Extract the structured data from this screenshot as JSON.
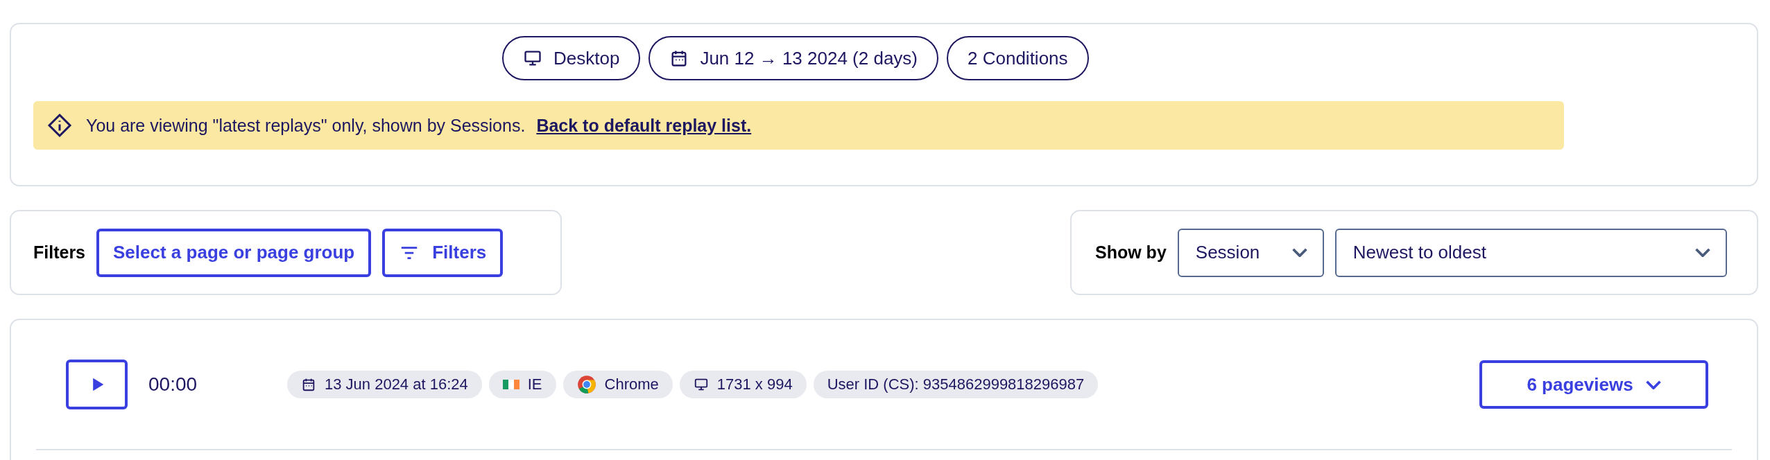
{
  "summary_pills": [
    {
      "kind": "device",
      "label": "Desktop"
    },
    {
      "kind": "date",
      "label": "Jun 12 → 13 2024 (2 days)"
    },
    {
      "kind": "plain",
      "label": "2 Conditions"
    }
  ],
  "notice": {
    "text": "You are viewing \"latest replays\" only, shown by Sessions.",
    "link": "Back to default replay list."
  },
  "filters": {
    "label": "Filters",
    "page_select": "Select a page or page group",
    "filters_button": "Filters"
  },
  "show_by": {
    "label": "Show by",
    "grouping": "Session",
    "sort": "Newest to oldest"
  },
  "sessions": [
    {
      "duration": "00:00",
      "pageviews": "6 pageviews",
      "chips": [
        {
          "kind": "date",
          "text": "13 Jun 2024 at 16:24"
        },
        {
          "kind": "flag",
          "text": "IE"
        },
        {
          "kind": "browser",
          "text": "Chrome"
        },
        {
          "kind": "screen",
          "text": "1731 x 994"
        },
        {
          "kind": "plain",
          "text": "User ID (CS): 9354862999818296987"
        }
      ]
    }
  ]
}
